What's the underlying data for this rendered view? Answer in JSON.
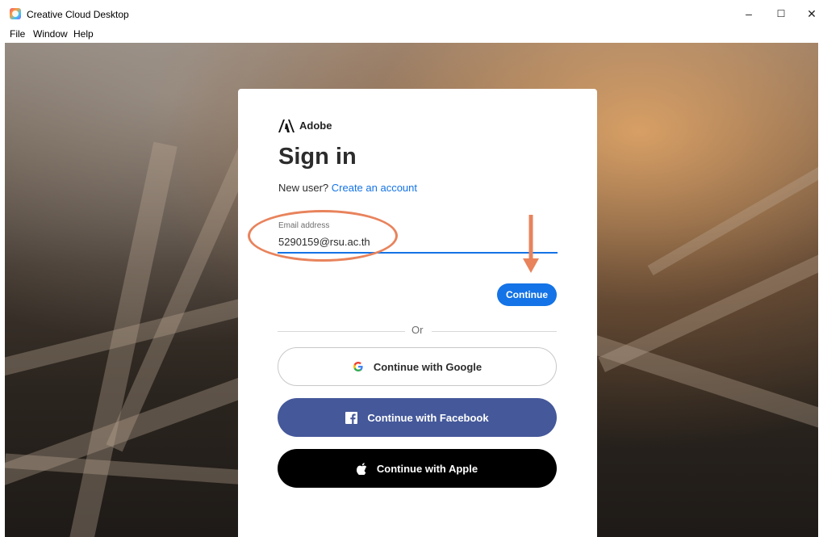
{
  "window": {
    "title": "Creative Cloud Desktop",
    "controls": {
      "minimize": "–",
      "maximize": "☐",
      "close": "✕"
    }
  },
  "menu": [
    "File",
    "Window",
    "Help"
  ],
  "signin": {
    "brand": "Adobe",
    "heading": "Sign in",
    "new_user_text": "New user?",
    "create_account_link": "Create an account",
    "email_label": "Email address",
    "email_value": "5290159@rsu.ac.th",
    "continue_label": "Continue",
    "or_text": "Or",
    "google_label": "Continue with Google",
    "facebook_label": "Continue with Facebook",
    "apple_label": "Continue with Apple"
  },
  "colors": {
    "accent": "#1473e6",
    "facebook": "#44589a",
    "apple": "#000000",
    "annotation": "#e8835c"
  },
  "icons": {
    "app": "creative-cloud-icon",
    "brand": "adobe-logo-icon",
    "google": "google-icon",
    "facebook": "facebook-icon",
    "apple": "apple-icon"
  }
}
